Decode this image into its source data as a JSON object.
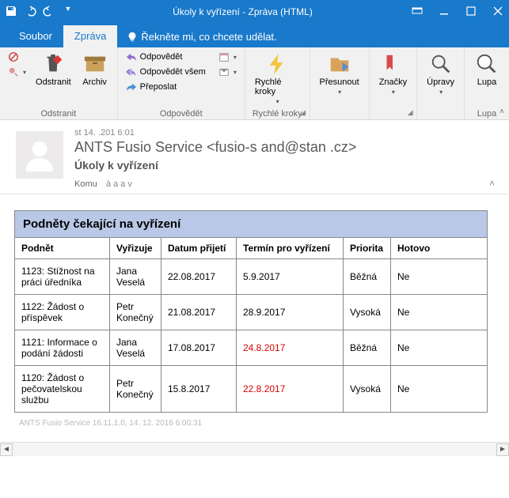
{
  "titlebar": {
    "title": "Úkoly k vyřízení  -  Zpráva (HTML)"
  },
  "tabs": {
    "file": "Soubor",
    "message": "Zpráva",
    "tell_me": "Řekněte mi, co chcete udělat."
  },
  "ribbon": {
    "delete": {
      "label": "Odstranit",
      "archive": "Archiv",
      "group": "Odstranit"
    },
    "respond": {
      "reply": "Odpovědět",
      "reply_all": "Odpovědět všem",
      "forward": "Přeposlat",
      "group": "Odpovědět"
    },
    "quicksteps": {
      "group": "Rychlé kroky"
    },
    "move": {
      "quick_steps": "Rychlé kroky",
      "move": "Přesunout",
      "tags": "Značky",
      "editing": "Úpravy",
      "zoom": "Lupa",
      "zoom_group": "Lupa"
    }
  },
  "message": {
    "date": "st 14.   .201   6:01",
    "from": "ANTS Fusio Service <fusio-s  and@stan  .cz>",
    "subject": "Úkoly k vyřízení",
    "to_label": "Komu",
    "to": "  á   a    a    v"
  },
  "table": {
    "title": "Podněty čekající na vyřízení",
    "headers": {
      "podnet": "Podnět",
      "vyrizuje": "Vyřizuje",
      "datum": "Datum přijetí",
      "termin": "Termín pro vyřízení",
      "priorita": "Priorita",
      "hotovo": "Hotovo"
    },
    "rows": [
      {
        "podnet": "1123: Stížnost na práci úředníka",
        "vyrizuje": "Jana Veselá",
        "datum": "22.08.2017",
        "termin": "5.9.2017",
        "priorita": "Běžná",
        "hotovo": "Ne",
        "overdue": false
      },
      {
        "podnet": "1122: Žádost o příspěvek",
        "vyrizuje": "Petr Konečný",
        "datum": "21.08.2017",
        "termin": "28.9.2017",
        "priorita": "Vysoká",
        "hotovo": "Ne",
        "overdue": false
      },
      {
        "podnet": "1121: Informace o podání žádosti",
        "vyrizuje": "Jana Veselá",
        "datum": "17.08.2017",
        "termin": "24.8.2017",
        "priorita": "Běžná",
        "hotovo": "Ne",
        "overdue": true
      },
      {
        "podnet": "1120: Žádost o pečovatelskou službu",
        "vyrizuje": "Petr Konečný",
        "datum": "15.8.2017",
        "termin": "22.8.2017",
        "priorita": "Vysoká",
        "hotovo": "Ne",
        "overdue": true
      }
    ]
  },
  "footer": "ANTS Fusio Service 16.11.1.0, 14. 12. 2016 6:00:31"
}
